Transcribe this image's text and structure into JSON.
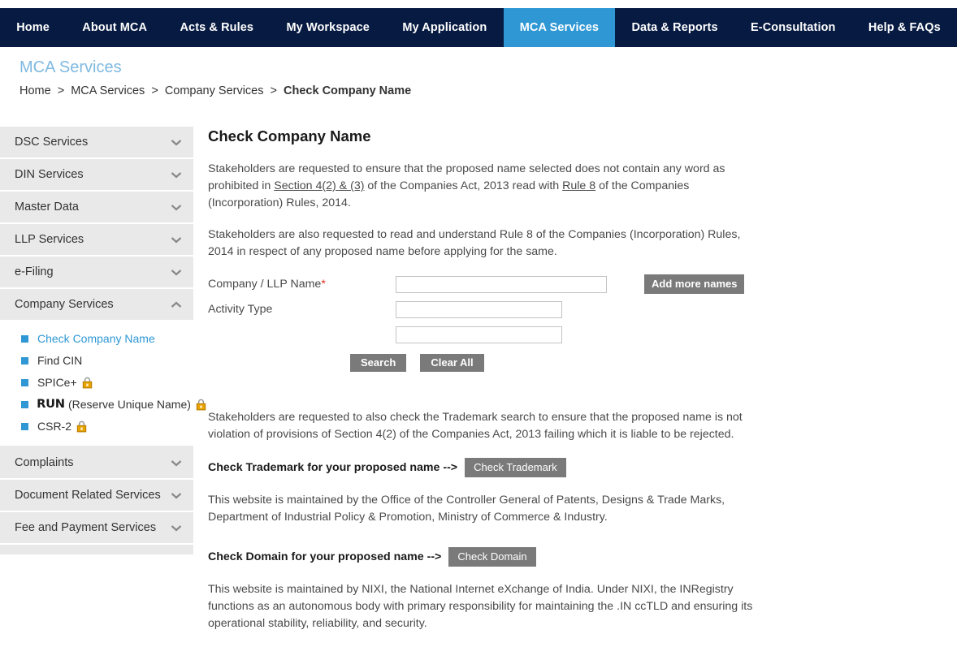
{
  "navbar": {
    "items": [
      {
        "label": "Home",
        "active": false
      },
      {
        "label": "About MCA",
        "active": false
      },
      {
        "label": "Acts & Rules",
        "active": false
      },
      {
        "label": "My Workspace",
        "active": false
      },
      {
        "label": "My Application",
        "active": false
      },
      {
        "label": "MCA Services",
        "active": true
      },
      {
        "label": "Data & Reports",
        "active": false
      },
      {
        "label": "E-Consultation",
        "active": false
      },
      {
        "label": "Help & FAQs",
        "active": false
      }
    ],
    "active_color": "#2e97d4",
    "background_color": "#071a42"
  },
  "page_head": {
    "title": "MCA Services",
    "breadcrumb": [
      {
        "label": "Home",
        "current": false
      },
      {
        "label": "MCA Services",
        "current": false
      },
      {
        "label": "Company Services",
        "current": false
      },
      {
        "label": "Check Company Name",
        "current": true
      }
    ],
    "separator": ">"
  },
  "sidebar": {
    "accordions": [
      {
        "label": "DSC Services",
        "expanded": false,
        "icon": "chevron-down-icon"
      },
      {
        "label": "DIN Services",
        "expanded": false,
        "icon": "chevron-down-icon"
      },
      {
        "label": "Master Data",
        "expanded": false,
        "icon": "chevron-down-icon"
      },
      {
        "label": "LLP Services",
        "expanded": false,
        "icon": "chevron-down-icon"
      },
      {
        "label": "e-Filing",
        "expanded": false,
        "icon": "chevron-down-icon"
      },
      {
        "label": "Company Services",
        "expanded": true,
        "icon": "chevron-up-icon"
      }
    ],
    "company_services_items": [
      {
        "label": "Check Company Name",
        "active": true,
        "locked": false,
        "logo": false
      },
      {
        "label": "Find CIN",
        "active": false,
        "locked": false,
        "logo": false
      },
      {
        "label": "SPICe+",
        "active": false,
        "locked": true,
        "logo": false
      },
      {
        "label": "(Reserve Unique Name)",
        "logo_text": "RUN",
        "active": false,
        "locked": true,
        "logo": true
      },
      {
        "label": "CSR-2",
        "active": false,
        "locked": true,
        "logo": false
      }
    ],
    "accordions_bottom": [
      {
        "label": "Complaints",
        "expanded": false,
        "icon": "chevron-down-icon"
      },
      {
        "label": "Document Related Services",
        "expanded": false,
        "icon": "chevron-down-icon"
      },
      {
        "label": "Fee and Payment Services",
        "expanded": false,
        "icon": "chevron-down-icon"
      }
    ],
    "bullet_color": "#2e97d4",
    "item_background": "#e9e9e9"
  },
  "main": {
    "title": "Check Company Name",
    "para1_a": "Stakeholders are requested to ensure that the proposed name selected does not contain any word as prohibited in ",
    "para1_link1": "Section 4(2) & (3)",
    "para1_b": " of the Companies Act, 2013 read with ",
    "para1_link2": "Rule 8",
    "para1_c": " of the Companies (Incorporation) Rules, 2014.",
    "para2": "Stakeholders are also requested to read and understand Rule 8 of the Companies (Incorporation) Rules, 2014 in respect of any proposed name before applying for the same.",
    "form": {
      "company_name_label": "Company / LLP Name",
      "company_name_required_mark": "*",
      "company_name_value": "",
      "company_name_placeholder": "",
      "activity_type_label": "Activity Type",
      "activity_type_value": "",
      "activity_type_placeholder": "",
      "activity_type_value2": "",
      "add_more_names_label": "Add more names",
      "search_label": "Search",
      "clear_all_label": "Clear All"
    },
    "para3": "Stakeholders are requested to also check the Trademark search to ensure that the proposed name is not violation of provisions of Section 4(2) of the Companies Act, 2013 failing which it is liable to be rejected.",
    "trademark_prompt": "Check Trademark for your proposed name -->",
    "trademark_button": "Check Trademark",
    "para4": "This website is maintained by the Office of the Controller General of Patents, Designs & Trade Marks, Department of Industrial Policy & Promotion, Ministry of Commerce & Industry.",
    "domain_prompt": "Check Domain for your proposed name -->",
    "domain_button": "Check Domain",
    "para5": "This website is maintained by NIXI, the National Internet eXchange of India. Under NIXI, the INRegistry functions as an autonomous body with primary responsibility for maintaining the .IN ccTLD and ensuring its operational stability, reliability, and security."
  }
}
